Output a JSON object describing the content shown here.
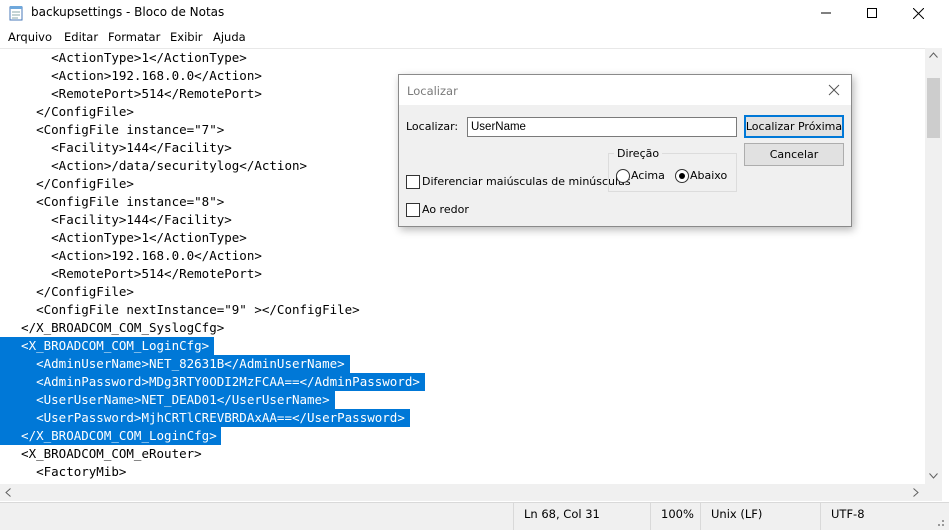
{
  "window": {
    "title": "backupsettings - Bloco de Notas"
  },
  "menu": [
    "Arquivo",
    "Editar",
    "Formatar",
    "Exibir",
    "Ajuda"
  ],
  "editor_lines": [
    "      <ActionType>1</ActionType>",
    "      <Action>192.168.0.0</Action>",
    "      <RemotePort>514</RemotePort>",
    "    </ConfigFile>",
    "    <ConfigFile instance=\"7\">",
    "      <Facility>144</Facility>",
    "      <Action>/data/securitylog</Action>",
    "    </ConfigFile>",
    "    <ConfigFile instance=\"8\">",
    "      <Facility>144</Facility>",
    "      <ActionType>1</ActionType>",
    "      <Action>192.168.0.0</Action>",
    "      <RemotePort>514</RemotePort>",
    "    </ConfigFile>",
    "    <ConfigFile nextInstance=\"9\" ></ConfigFile>",
    "  </X_BROADCOM_COM_SyslogCfg>",
    "  <X_BROADCOM_COM_LoginCfg>",
    "    <AdminUserName>NET_82631B</AdminUserName>",
    "    <AdminPassword>MDg3RTY0ODI2MzFCAA==</AdminPassword>",
    "    <UserUserName>NET_DEAD01</UserUserName>",
    "    <UserPassword>MjhCRTlCREVBRDAxAA==</UserPassword>",
    "  </X_BROADCOM_COM_LoginCfg>",
    "  <X_BROADCOM_COM_eRouter>",
    "    <FactoryMib>"
  ],
  "selected_lines": [
    16,
    17,
    18,
    19,
    20,
    21
  ],
  "status": {
    "position": "Ln 68, Col 31",
    "zoom": "100%",
    "line_ending": "Unix (LF)",
    "encoding": "UTF-8"
  },
  "find_dialog": {
    "title": "Localizar",
    "find_label": "Localizar:",
    "find_value": "UserName",
    "find_next_label": "Localizar Próxima",
    "cancel_label": "Cancelar",
    "match_case_label": "Diferenciar maiúsculas de minúsculas",
    "match_case_checked": false,
    "wrap_label": "Ao redor",
    "wrap_checked": false,
    "direction_label": "Direção",
    "up_label": "Acima",
    "down_label": "Abaixo",
    "direction_selected": "Abaixo"
  },
  "colors": {
    "selection": "#0078d7",
    "status_bg": "#f0f0f0",
    "dialog_bg": "#f0f0f0"
  }
}
